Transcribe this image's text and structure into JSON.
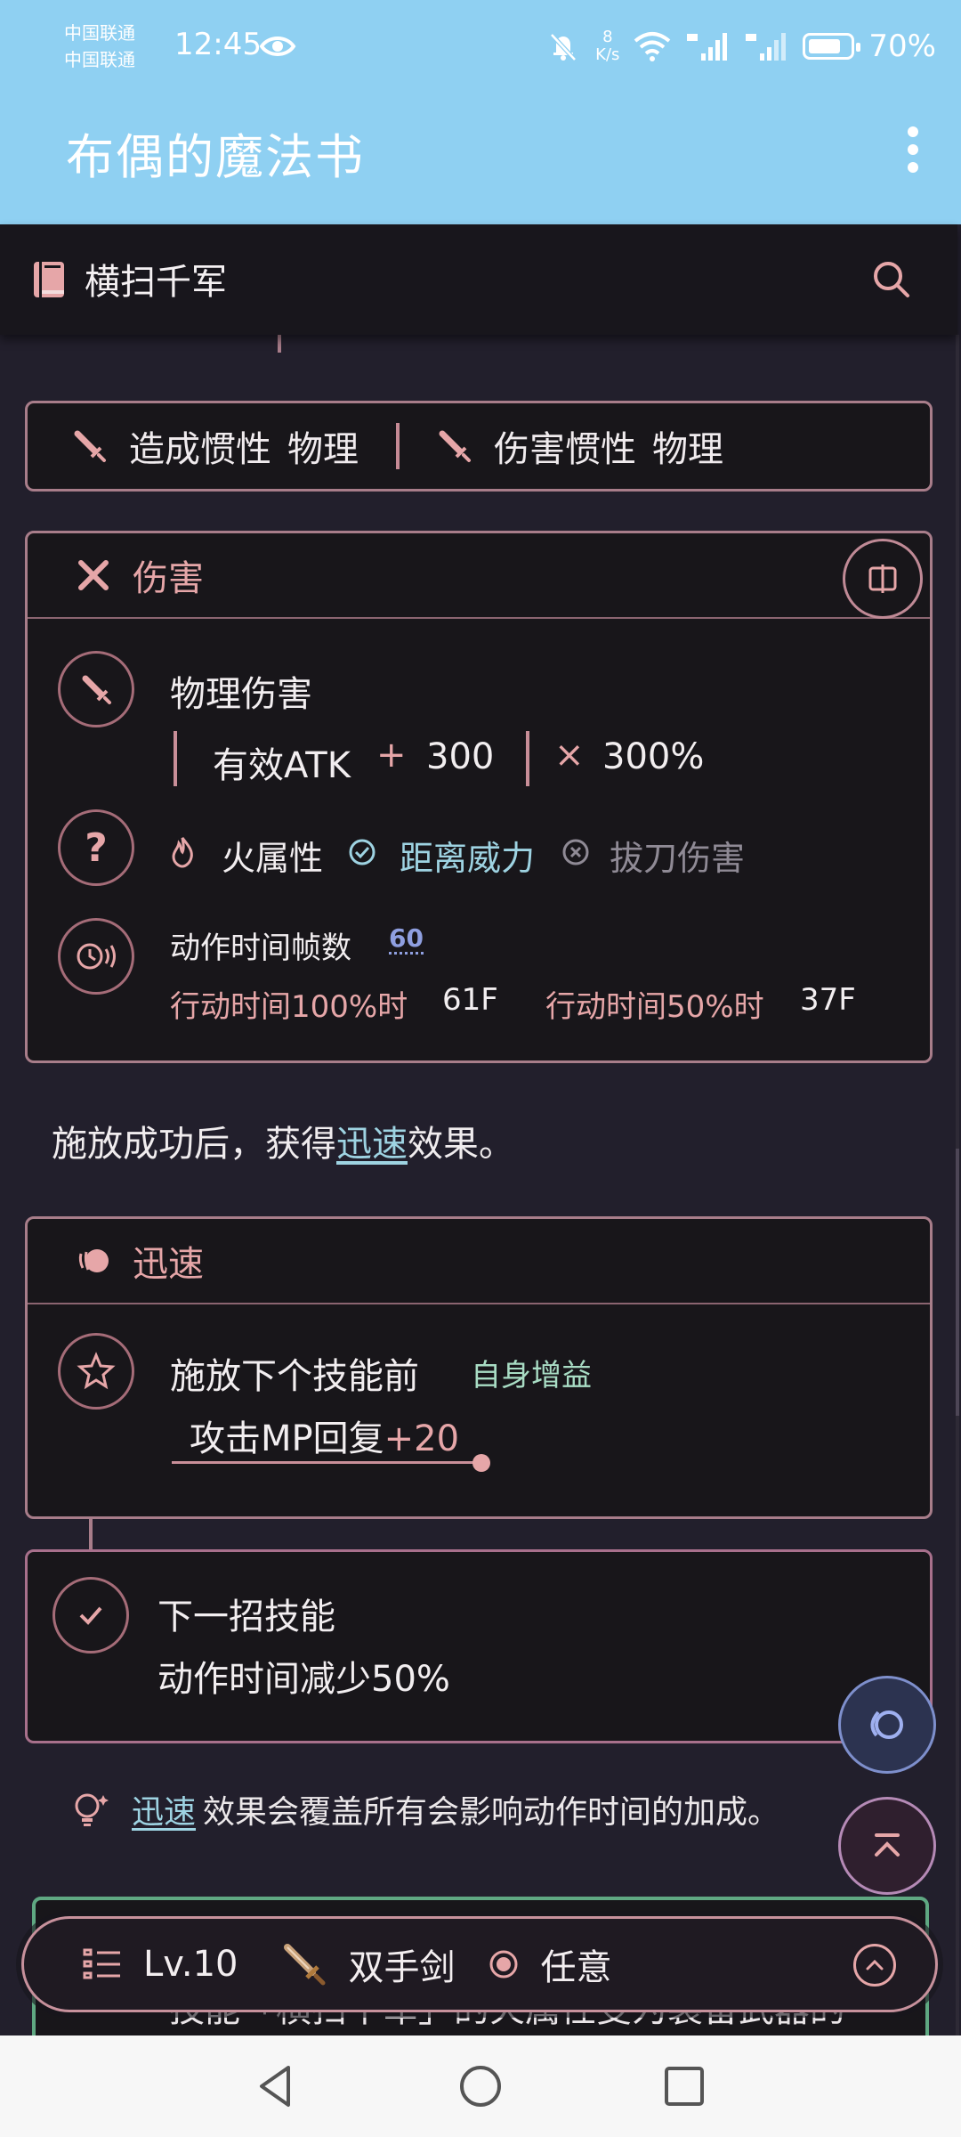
{
  "status_bar": {
    "carrier_1": "中国联通",
    "carrier_2": "中国联通",
    "time": "12:45",
    "net_speed_value": "8",
    "net_speed_unit": "K/s",
    "battery": "70%",
    "battery_level_percent": 70
  },
  "app_bar": {
    "title": "布偶的魔法书"
  },
  "sub_header": {
    "title": "横扫千军"
  },
  "inertia": {
    "items": [
      {
        "label": "造成惯性",
        "value": "物理"
      },
      {
        "label": "伤害惯性",
        "value": "物理"
      }
    ]
  },
  "damage": {
    "title": "伤害",
    "type_label": "物理伤害",
    "formula_base": "有效ATK",
    "formula_plus": "+",
    "formula_add": "300",
    "formula_times": "×",
    "formula_mult": "300%",
    "tags": [
      {
        "label": "火属性",
        "icon": "flame-icon"
      },
      {
        "label": "距离威力",
        "icon": "check-circle-icon"
      },
      {
        "label": "拔刀伤害",
        "icon": "x-circle-icon"
      }
    ],
    "frames_title": "动作时间帧数",
    "frames_badge": "60",
    "frames_100_label": "行动时间100%时",
    "frames_100_value": "61F",
    "frames_50_label": "行动时间50%时",
    "frames_50_value": "37F"
  },
  "description": {
    "prefix": "施放成功后，获得",
    "link": "迅速",
    "suffix": "效果。"
  },
  "swift": {
    "title": "迅速",
    "condition": "施放下个技能前",
    "tag": "自身增益",
    "effect_label": "攻击MP回复",
    "effect_value": "+20"
  },
  "next_skill": {
    "title": "下一招技能",
    "effect": "动作时间减少50%"
  },
  "note": {
    "link": "迅速",
    "text": "效果会覆盖所有会影响动作时间的加成。"
  },
  "green_card": {
    "text": "技能「横扫千军」的火属性变为装备武器的"
  },
  "bottom_bar": {
    "level": "Lv.10",
    "weapon": "双手剑",
    "option": "任意"
  },
  "colors": {
    "accent_pink": "#e6a6a8",
    "border_pink": "#a87d8a",
    "link_teal": "#9ed3e2",
    "top_bar_blue": "#8fd0f2",
    "green_border": "#5fa882"
  }
}
